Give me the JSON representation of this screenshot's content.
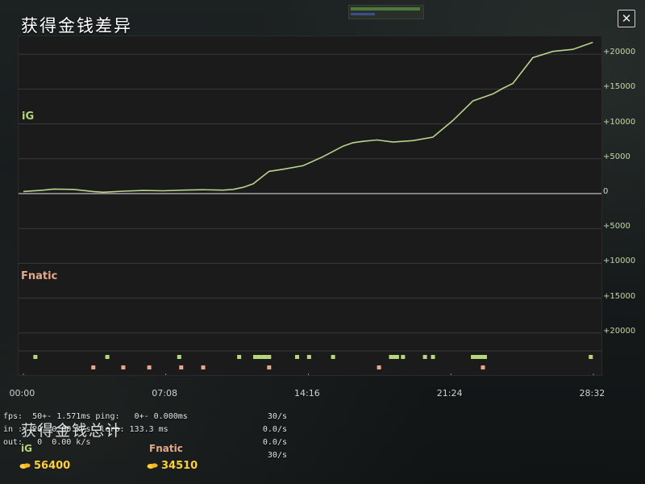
{
  "title": "获得金钱差异",
  "close_label": "✕",
  "teams": {
    "top": "iG",
    "bottom": "Fnatic"
  },
  "y_ticks": [
    {
      "label": "+20000",
      "value": 20000
    },
    {
      "label": "+15000",
      "value": 15000
    },
    {
      "label": "+10000",
      "value": 10000
    },
    {
      "label": "+5000",
      "value": 5000
    },
    {
      "label": "0",
      "value": 0
    },
    {
      "label": "+5000",
      "value": -5000
    },
    {
      "label": "+10000",
      "value": -10000
    },
    {
      "label": "+15000",
      "value": -15000
    },
    {
      "label": "+20000",
      "value": -20000
    }
  ],
  "x_ticks": [
    "00:00",
    "07:08",
    "14:16",
    "21:24",
    "28:32"
  ],
  "colors": {
    "ig": "#b6d67c",
    "fnatic": "#e6a88a",
    "gold": "#ffcf3a",
    "line": "#b9d48a",
    "grid": "#3a3a3a"
  },
  "chart_data": {
    "type": "line",
    "x_unit": "minutes",
    "xlim": [
      0,
      28.53
    ],
    "ylim": [
      -25000,
      23000
    ],
    "series": [
      {
        "name": "",
        "x": [
          0,
          1,
          1.5,
          2.5,
          3.5,
          4,
          5,
          6,
          7,
          8,
          9,
          10,
          10.5,
          11,
          11.5,
          12.3,
          13,
          14,
          15,
          16,
          16.5,
          17,
          17.7,
          18.5,
          19.5,
          20.5,
          21.5,
          22.5,
          23,
          23.5,
          24,
          24.5,
          25.5,
          26.5,
          27.5,
          28.5
        ],
        "values": [
          300,
          500,
          650,
          600,
          300,
          200,
          350,
          450,
          400,
          500,
          550,
          500,
          600,
          900,
          1400,
          3200,
          3500,
          4000,
          5300,
          6800,
          7300,
          7500,
          7700,
          7400,
          7600,
          8100,
          10500,
          13300,
          13800,
          14300,
          15100,
          15800,
          19500,
          20400,
          20700,
          21700
        ]
      }
    ],
    "events_ig": [
      0.6,
      4.2,
      7.8,
      10.8,
      11.6,
      11.8,
      12.0,
      12.1,
      12.3,
      13.7,
      14.3,
      15.5,
      18.4,
      18.6,
      18.7,
      19.0,
      20.1,
      20.5,
      22.5,
      22.7,
      22.9,
      23.1,
      28.4
    ],
    "events_fnatic": [
      3.5,
      5.0,
      6.3,
      7.9,
      9.0,
      12.3,
      17.8,
      23.0
    ]
  },
  "debug": {
    "line1": "fps:  50+- 1.571ms ping:   0+- 0.000ms",
    "line2": "in :  20  0.00 k/s  lerp: 133.3 ms",
    "line3": "out:   0  0.00 k/s",
    "r1": "30/s",
    "r2": "0.0/s",
    "r3": "0.0/s",
    "r4": "30/s"
  },
  "totals": {
    "title": "获得金钱总计",
    "ig_label": "iG",
    "ig_value": "56400",
    "fnatic_label": "Fnatic",
    "fnatic_value": "34510"
  }
}
